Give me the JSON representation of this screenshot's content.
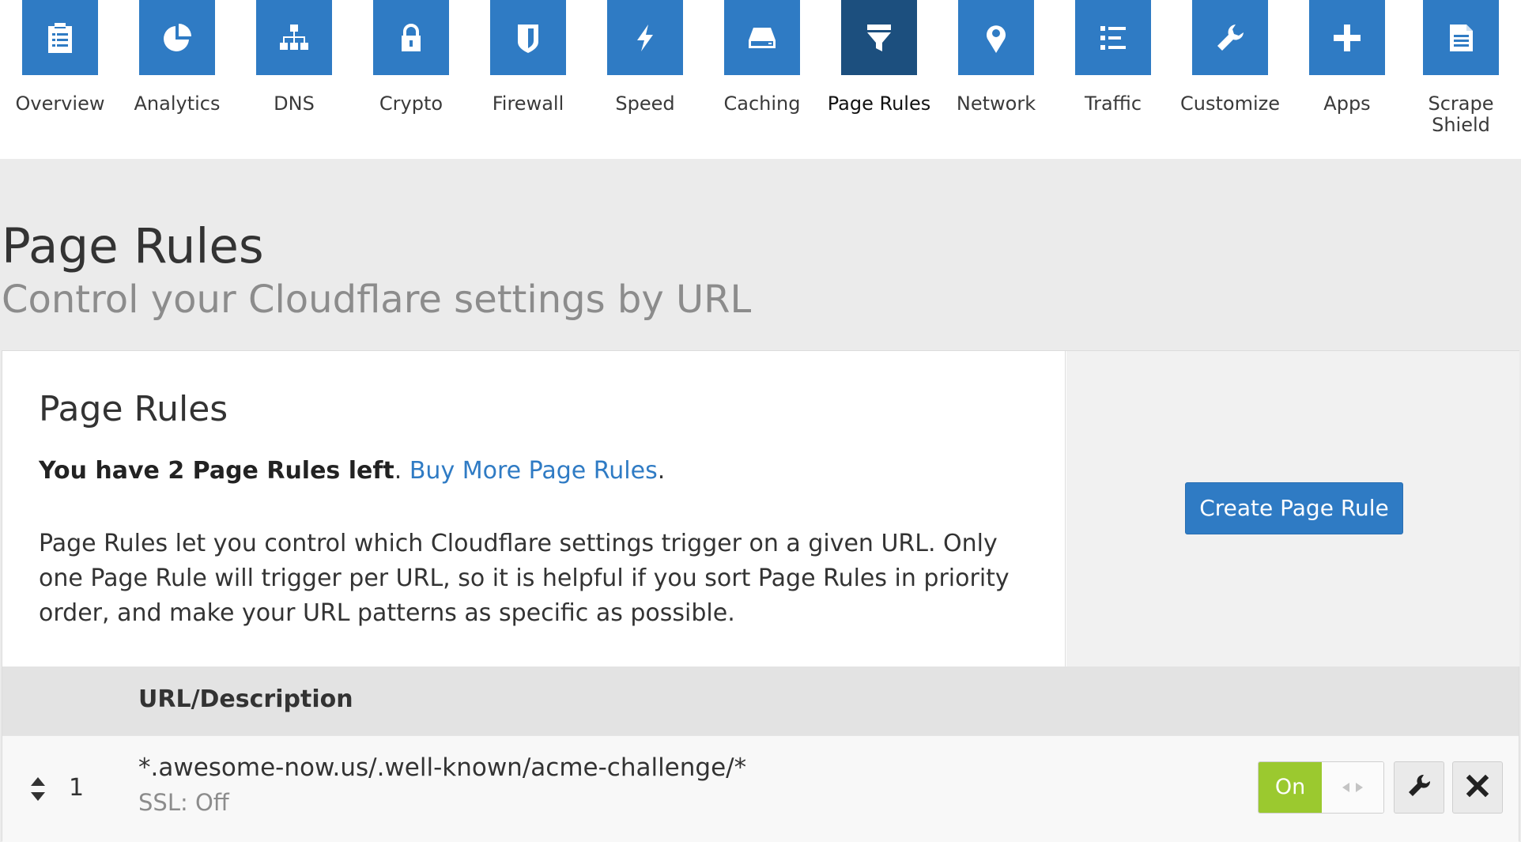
{
  "nav": {
    "active": "Page Rules",
    "items": [
      {
        "label": "Overview",
        "icon": "clipboard-icon"
      },
      {
        "label": "Analytics",
        "icon": "pie-chart-icon"
      },
      {
        "label": "DNS",
        "icon": "sitemap-icon"
      },
      {
        "label": "Crypto",
        "icon": "lock-icon"
      },
      {
        "label": "Firewall",
        "icon": "shield-icon"
      },
      {
        "label": "Speed",
        "icon": "lightning-icon"
      },
      {
        "label": "Caching",
        "icon": "hard-drive-icon"
      },
      {
        "label": "Page Rules",
        "icon": "filter-icon"
      },
      {
        "label": "Network",
        "icon": "map-pin-icon"
      },
      {
        "label": "Traffic",
        "icon": "list-icon"
      },
      {
        "label": "Customize",
        "icon": "wrench-icon"
      },
      {
        "label": "Apps",
        "icon": "plus-icon"
      },
      {
        "label": "Scrape Shield",
        "icon": "document-icon"
      }
    ]
  },
  "header": {
    "title": "Page Rules",
    "subtitle": "Control your Cloudflare settings by URL"
  },
  "card": {
    "title": "Page Rules",
    "quota_text": "You have 2 Page Rules left",
    "quota_sep": ". ",
    "buy_link": "Buy More Page Rules",
    "buy_end": ".",
    "description": "Page Rules let you control which Cloudflare settings trigger on a given URL. Only one Page Rule will trigger per URL, so it is helpful if you sort Page Rules in priority order, and make your URL patterns as specific as possible.",
    "create_button": "Create Page Rule"
  },
  "table": {
    "column_url": "URL/Description",
    "rows": [
      {
        "priority": "1",
        "url": "*.awesome-now.us/.well-known/acme-challenge/*",
        "setting": "SSL: Off",
        "toggle_label": "On"
      }
    ]
  },
  "colors": {
    "accent": "#2f7bc4",
    "active_tab": "#1c4f7e",
    "toggle_on": "#9bc92f"
  }
}
